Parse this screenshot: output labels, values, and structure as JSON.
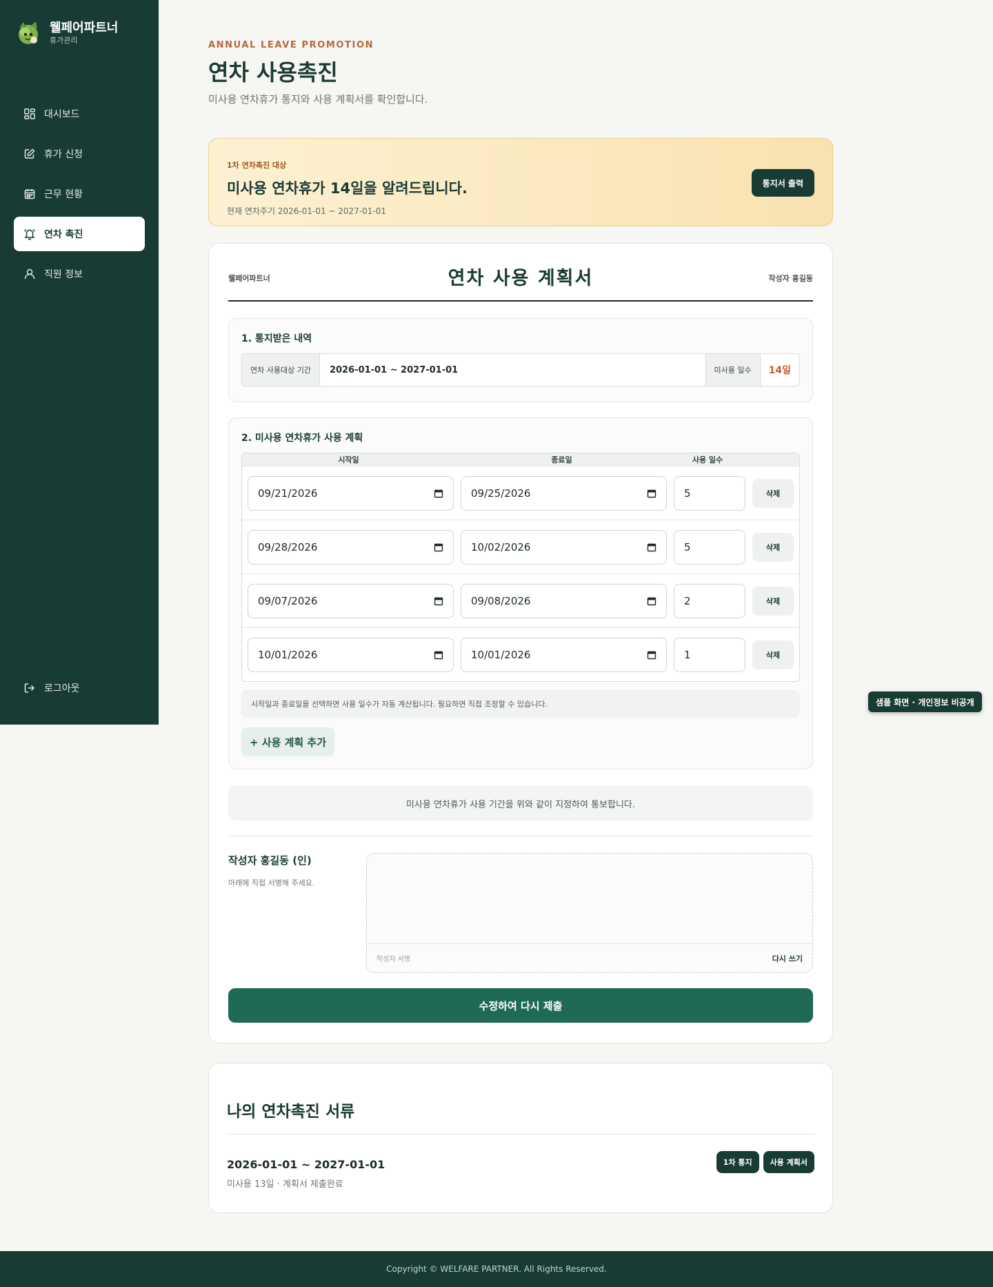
{
  "brand": {
    "name": "웰페어파트너",
    "subtitle": "휴가관리"
  },
  "nav": {
    "items": [
      {
        "label": "대시보드",
        "icon": "dashboard-icon"
      },
      {
        "label": "휴가 신청",
        "icon": "edit-icon"
      },
      {
        "label": "근무 현황",
        "icon": "calendar-icon"
      },
      {
        "label": "연차 촉진",
        "icon": "bell-icon",
        "active": true
      },
      {
        "label": "직원 정보",
        "icon": "user-icon"
      }
    ],
    "logout": "로그아웃"
  },
  "header": {
    "eyebrow": "ANNUAL LEAVE PROMOTION",
    "title": "연차 사용촉진",
    "subtitle": "미사용 연차휴가 통지와 사용 계획서를 확인합니다."
  },
  "notice": {
    "tag": "1차 연차촉진 대상",
    "title": "미사용 연차휴가 14일을 알려드립니다.",
    "cycle": "현재 연차주기 2026-01-01 ~ 2027-01-01",
    "print_button": "통지서 출력"
  },
  "document": {
    "company": "웰페어파트너",
    "title": "연차 사용 계획서",
    "author": "작성자 홍길동",
    "received": {
      "title": "1. 통지받은 내역",
      "period_label": "연차 사용대상 기간",
      "period_value": "2026-01-01 ~ 2027-01-01",
      "unused_label": "미사용 일수",
      "unused_value": "14일"
    },
    "plan": {
      "title": "2. 미사용 연차휴가 사용 계획",
      "headers": {
        "start": "시작일",
        "end": "종료일",
        "days": "사용 일수"
      },
      "rows": [
        {
          "start": "09/21/2026",
          "end": "09/25/2026",
          "days": "5",
          "delete": "삭제"
        },
        {
          "start": "09/28/2026",
          "end": "10/02/2026",
          "days": "5",
          "delete": "삭제"
        },
        {
          "start": "09/07/2026",
          "end": "09/08/2026",
          "days": "2",
          "delete": "삭제"
        },
        {
          "start": "10/01/2026",
          "end": "10/01/2026",
          "days": "1",
          "delete": "삭제"
        }
      ],
      "hint": "시작일과 종료일을 선택하면 사용 일수가 자동 계산됩니다. 필요하면 직접 조정할 수 있습니다.",
      "add_button": "+ 사용 계획 추가"
    },
    "statement": "미사용 연차휴가 사용 기간을 위와 같이 지정하여 통보합니다.",
    "signature": {
      "title": "작성자 홍길동 (인)",
      "desc": "아래에 직접 서명해 주세요.",
      "pad_label": "작성자 서명",
      "clear_button": "다시 쓰기"
    },
    "submit_button": "수정하여 다시 제출"
  },
  "my_docs": {
    "title": "나의 연차촉진 서류",
    "items": [
      {
        "period": "2026-01-01 ~ 2027-01-01",
        "status": "미사용 13일 · 계획서 제출완료",
        "buttons": [
          "1차 통지",
          "사용 계획서"
        ]
      }
    ]
  },
  "privacy_badge": "샘플 화면 · 개인정보 비공개",
  "footer": "Copyright © WELFARE PARTNER. All Rights Reserved."
}
